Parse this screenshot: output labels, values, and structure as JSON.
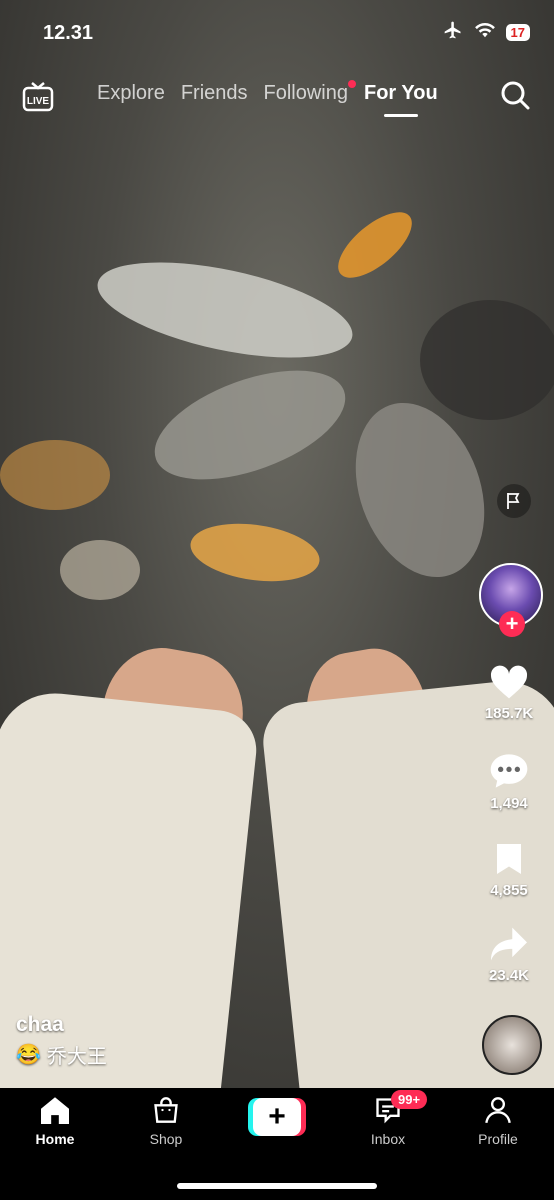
{
  "status": {
    "time": "12.31",
    "battery": "17"
  },
  "nav": {
    "tabs": [
      {
        "label": "Explore"
      },
      {
        "label": "Friends"
      },
      {
        "label": "Following"
      },
      {
        "label": "For You"
      }
    ]
  },
  "actions": {
    "likes": "185.7K",
    "comments": "1,494",
    "saves": "4,855",
    "shares": "23.4K"
  },
  "post": {
    "username": "chaa",
    "caption": "乔大王"
  },
  "bottom_nav": {
    "home": "Home",
    "shop": "Shop",
    "inbox": "Inbox",
    "inbox_badge": "99+",
    "profile": "Profile"
  },
  "colors": {
    "accent": "#fe2c55",
    "cyan": "#25f4ee"
  }
}
